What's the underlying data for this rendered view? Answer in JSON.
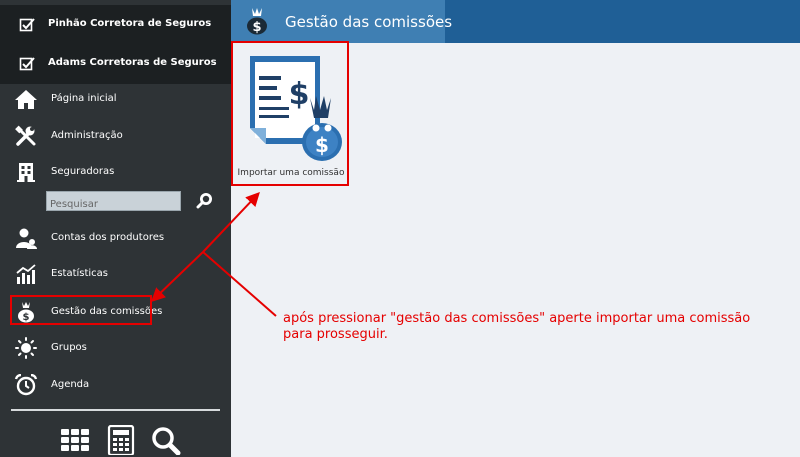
{
  "sidebar": {
    "companies": [
      {
        "label": "Pinhão Corretora de Seguros"
      },
      {
        "label": "Adams Corretoras de Seguros"
      }
    ],
    "items": [
      {
        "label": "Página inicial",
        "icon": "home-icon"
      },
      {
        "label": "Administração",
        "icon": "tools-icon"
      },
      {
        "label": "Seguradoras",
        "icon": "building-icon"
      },
      {
        "label": "Contas dos produtores",
        "icon": "users-icon"
      },
      {
        "label": "Estatísticas",
        "icon": "chart-icon"
      },
      {
        "label": "Gestão das comissões",
        "icon": "money-bag-icon"
      },
      {
        "label": "Grupos",
        "icon": "sun-icon"
      },
      {
        "label": "Agenda",
        "icon": "alarm-clock-icon"
      }
    ],
    "search": {
      "placeholder": "Pesquisar",
      "value": ""
    },
    "tools": [
      "grid-icon",
      "calculator-icon",
      "search-icon"
    ]
  },
  "header": {
    "title": "Gestão das comissões",
    "icon": "money-bag-icon"
  },
  "main": {
    "tiles": [
      {
        "label": "Importar uma comissão",
        "icon": "import-commission-icon"
      }
    ]
  },
  "annotation": {
    "text": "após pressionar \"gestão das comissões\" aperte importar uma comissão para prosseguir."
  },
  "colors": {
    "sidebar_bg": "#2e3336",
    "company_bg": "#1c2022",
    "header_bg": "#1f5f96",
    "header_tab_bg": "#3f7fb3",
    "content_bg": "#eef1f5",
    "annotation_red": "#e50000"
  }
}
